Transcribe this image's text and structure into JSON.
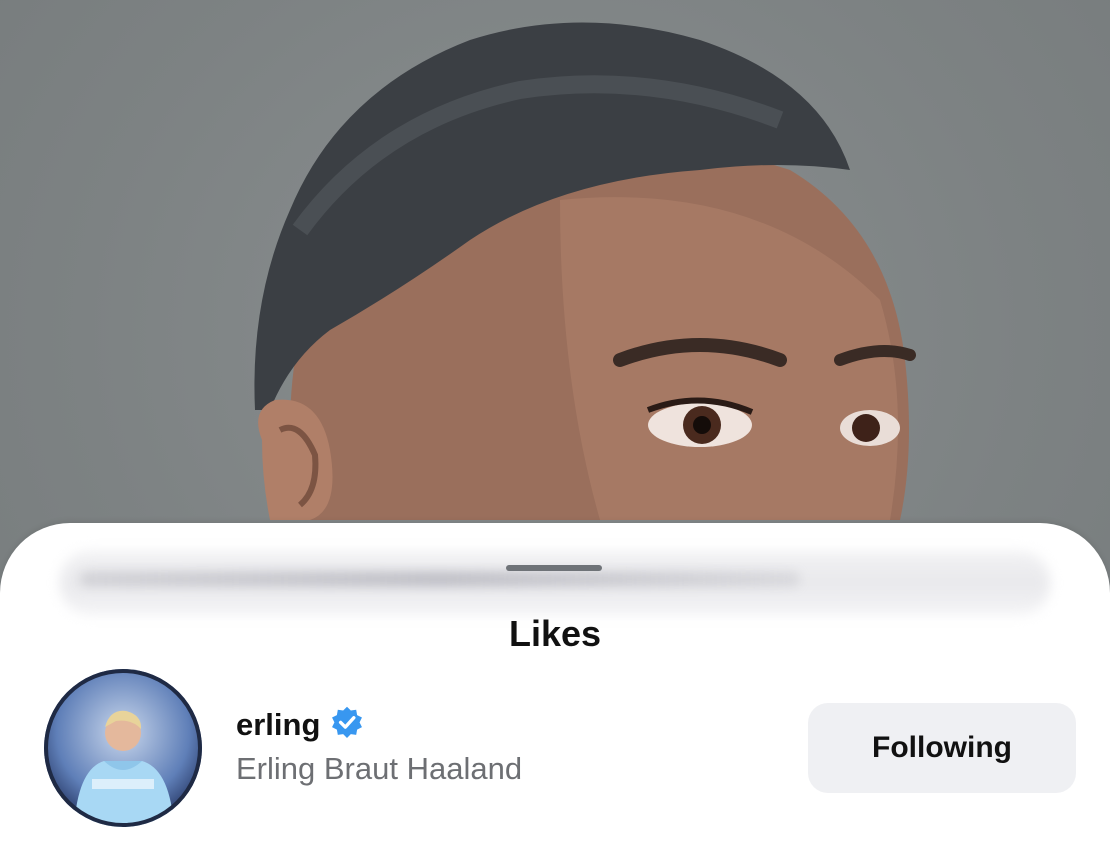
{
  "sheet": {
    "title": "Likes"
  },
  "likes": [
    {
      "username": "erling",
      "full_name": "Erling Braut Haaland",
      "verified": true,
      "button_label": "Following"
    }
  ],
  "colors": {
    "verified_badge": "#3897f0",
    "button_bg": "#eff0f3",
    "secondary_text": "#6d6f73"
  },
  "icons": {
    "verified": "verified-badge-icon"
  }
}
